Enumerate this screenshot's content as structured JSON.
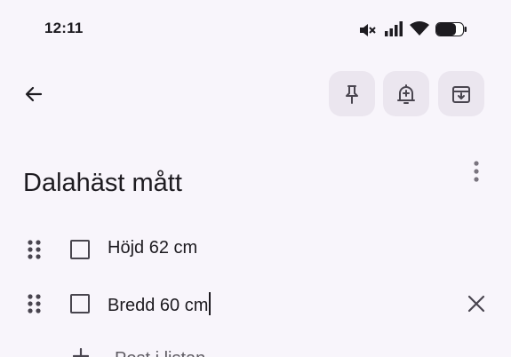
{
  "status_bar": {
    "time": "12:11",
    "icons": [
      "mute-vibrate-icon",
      "cellular-signal-icon",
      "wifi-icon",
      "battery-icon"
    ]
  },
  "toolbar": {
    "back_icon": "arrow-back-icon",
    "pin_icon": "pin-icon",
    "reminder_icon": "bell-plus-icon",
    "archive_icon": "archive-icon",
    "button_bg": "#ebe6ef"
  },
  "note": {
    "title": "Dalahäst mått",
    "more_icon": "more-vert-icon",
    "items": [
      {
        "text": "Höjd 62 cm",
        "checked": false,
        "editing": false
      },
      {
        "text": "Bredd 60 cm",
        "checked": false,
        "editing": true
      }
    ],
    "add_item_label": "Post i listan"
  },
  "colors": {
    "background": "#f8f5fb",
    "text": "#1d1b20",
    "icon": "#49454f"
  }
}
